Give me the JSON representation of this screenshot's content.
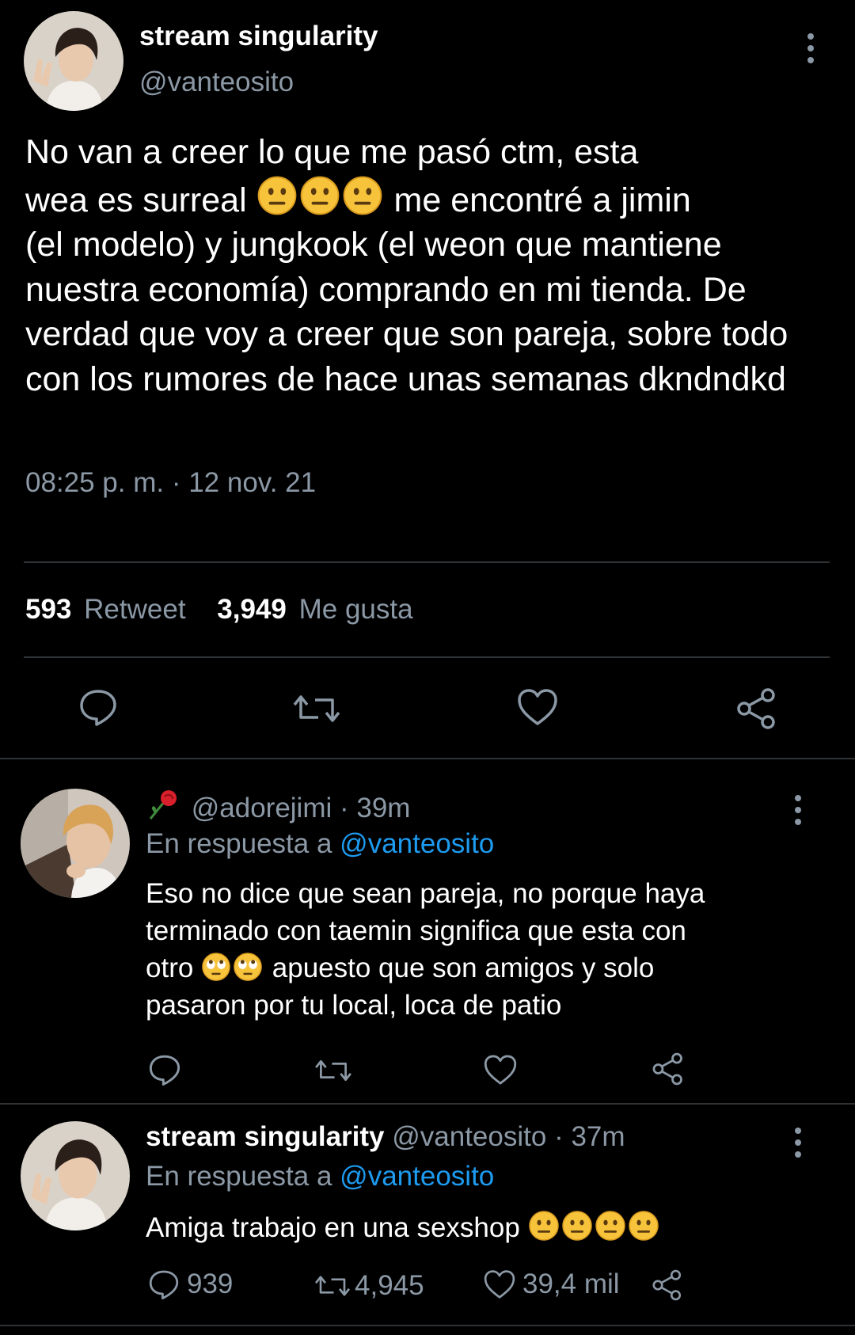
{
  "main_tweet": {
    "display_name": "stream singularity",
    "handle": "@vanteosito",
    "text_line1": "No van a creer lo que me pasó ctm, esta",
    "text_line2a": "wea es surreal",
    "text_line2b": "me encontré a jimin",
    "text_rest": "(el modelo) y jungkook (el weon que mantiene nuestra economía) comprando en mi tienda. De verdad que voy a creer que son pareja, sobre todo con los rumores de hace unas semanas dkndndkd",
    "emoji_count": 3,
    "timestamp": "08:25 p. m. · 12 nov. 21",
    "stats": {
      "retweets_value": "593",
      "retweets_label": "Retweet",
      "likes_value": "3,949",
      "likes_label": "Me gusta"
    }
  },
  "replies": [
    {
      "handle": "@adorejimi",
      "time": "· 39m",
      "reply_prefix": "En respuesta a",
      "reply_to": "@vanteosito",
      "text_line1": "Eso no dice que sean pareja, no porque haya",
      "text_line2": "terminado con taemin significa que esta con",
      "text_line3a": "otro",
      "text_line3b": "apuesto que son amigos y solo",
      "text_line4": "pasaron por tu local, loca de patio"
    },
    {
      "display_name": "stream singularity",
      "handle": "@vanteosito",
      "time": "· 37m",
      "reply_prefix": "En respuesta a",
      "reply_to": "@vanteosito",
      "text": "Amiga trabajo en una sexshop",
      "counts": {
        "replies": "939",
        "retweets": "4,945",
        "likes": "39,4 mil"
      }
    }
  ],
  "colors": {
    "background": "#000000",
    "muted": "#8b98a5",
    "link": "#1d9bf0",
    "divider": "#2f3336",
    "emoji": "#f6c33b"
  }
}
